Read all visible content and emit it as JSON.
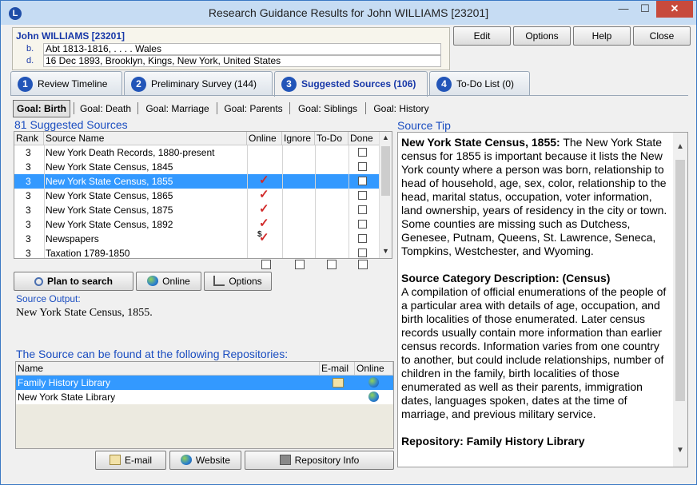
{
  "window": {
    "title": "Research Guidance Results for John WILLIAMS [23201]",
    "minimize": "—",
    "maximize": "☐",
    "close": "✕",
    "app_icon": "L"
  },
  "person": {
    "name": "John WILLIAMS [23201]",
    "events": [
      {
        "label": "b.",
        "value": "Abt 1813-1816, . . . . Wales"
      },
      {
        "label": "d.",
        "value": "16 Dec 1893, Brooklyn, Kings, New York, United States"
      }
    ]
  },
  "top_buttons": {
    "edit": "Edit",
    "options": "Options",
    "help": "Help",
    "close": "Close"
  },
  "tabs": [
    {
      "num": "1",
      "label": "Review Timeline"
    },
    {
      "num": "2",
      "label": "Preliminary Survey (144)"
    },
    {
      "num": "3",
      "label": "Suggested Sources (106)"
    },
    {
      "num": "4",
      "label": "To-Do List (0)"
    }
  ],
  "goals": [
    "Goal: Birth",
    "Goal: Death",
    "Goal: Marriage",
    "Goal: Parents",
    "Goal: Siblings",
    "Goal: History"
  ],
  "sources": {
    "heading": "81 Suggested Sources",
    "columns": {
      "rank": "Rank",
      "name": "Source Name",
      "online": "Online",
      "ignore": "Ignore",
      "todo": "To-Do",
      "done": "Done"
    },
    "rows": [
      {
        "rank": "3",
        "name": "New York Death Records, 1880-present",
        "online": ""
      },
      {
        "rank": "3",
        "name": "New York State Census, 1845",
        "online": ""
      },
      {
        "rank": "3",
        "name": "New York State Census, 1855",
        "online": "✓"
      },
      {
        "rank": "3",
        "name": "New York State Census, 1865",
        "online": "✓"
      },
      {
        "rank": "3",
        "name": "New York State Census, 1875",
        "online": "✓"
      },
      {
        "rank": "3",
        "name": "New York State Census, 1892",
        "online": "✓"
      },
      {
        "rank": "3",
        "name": "Newspapers",
        "online": "$✓"
      },
      {
        "rank": "3",
        "name": "Taxation 1789-1850",
        "online": ""
      }
    ],
    "selected_row": 2
  },
  "source_buttons": {
    "plan": "Plan to search",
    "online": "Online",
    "options": "Options"
  },
  "source_output": {
    "label": "Source Output:",
    "text": "New York State Census, 1855."
  },
  "repositories": {
    "heading": "The Source can be found at the following Repositories:",
    "columns": {
      "name": "Name",
      "email": "E-mail",
      "online": "Online"
    },
    "rows": [
      {
        "name": "Family History Library"
      },
      {
        "name": "New York State Library"
      }
    ]
  },
  "repo_buttons": {
    "email": "E-mail",
    "website": "Website",
    "info": "Repository Info"
  },
  "source_tip": {
    "heading": "Source Tip",
    "title1": "New York State Census, 1855:",
    "body1": " The New York State census for 1855 is important because it lists the New York county where a person was born, relationship to head of household, age, sex, color, relationship to the head, marital status, occupation, voter information, land ownership, years of residency in the city or town. Some counties are missing such as Dutchess, Genesee, Putnam, Queens, St. Lawrence, Seneca, Tompkins, Westchester, and Wyoming.",
    "title2": "Source Category Description: (Census)",
    "body2": "A compilation of official enumerations of the people of a particular area with details of age, occupation, and birth localities of those enumerated. Later census records usually contain more information than earlier census records. Information varies from one country to another, but could include relationships, number of children in the family, birth localities of those enumerated as well as their parents, immigration dates, languages spoken, dates at the time of marriage, and previous military service.",
    "title3": "Repository: Family History Library"
  },
  "colors": {
    "accent": "#1a4dc0",
    "selection": "#3399ff",
    "check": "#d12a2a"
  }
}
